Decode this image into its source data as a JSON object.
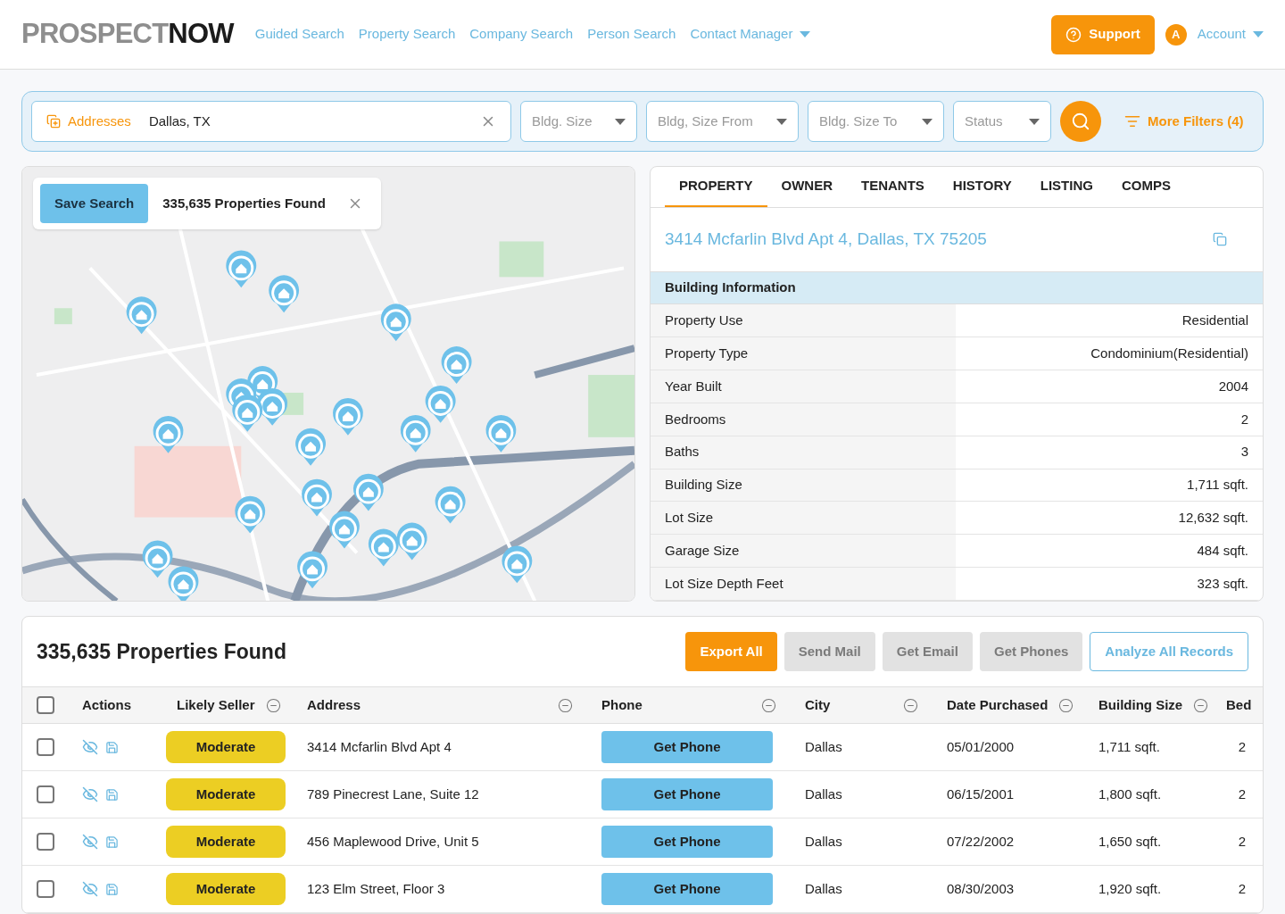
{
  "logo": {
    "part_1": "PROSPECT",
    "part_2": "NOW"
  },
  "nav": [
    {
      "label": "Guided Search",
      "dropdown": false
    },
    {
      "label": "Property Search",
      "dropdown": false
    },
    {
      "label": "Company Search",
      "dropdown": false
    },
    {
      "label": "Person Search",
      "dropdown": false
    },
    {
      "label": "Contact Manager",
      "dropdown": true
    }
  ],
  "support_button": "Support",
  "account": {
    "initial": "A",
    "label": "Account"
  },
  "search": {
    "type_label": "Addresses",
    "value": "Dallas, TX",
    "filters": [
      {
        "placeholder": "Bldg. Size"
      },
      {
        "placeholder": "Bldg, Size From"
      },
      {
        "placeholder": "Bldg. Size To"
      },
      {
        "placeholder": "Status"
      }
    ],
    "more_filters": "More Filters (4)"
  },
  "map": {
    "save_button": "Save Search",
    "result_count": "335,635 Properties Found"
  },
  "detail": {
    "tabs": [
      {
        "label": "PROPERTY",
        "selected": true
      },
      {
        "label": "OWNER",
        "selected": false
      },
      {
        "label": "TENANTS",
        "selected": false
      },
      {
        "label": "HISTORY",
        "selected": false
      },
      {
        "label": "LISTING",
        "selected": false
      },
      {
        "label": "COMPS",
        "selected": false
      }
    ],
    "address": "3414 Mcfarlin Blvd Apt 4, Dallas, TX 75205",
    "section": "Building Information",
    "rows": [
      {
        "label": "Property Use",
        "value": "Residential"
      },
      {
        "label": "Property Type",
        "value": "Condominium(Residential)"
      },
      {
        "label": "Year Built",
        "value": "2004"
      },
      {
        "label": "Bedrooms",
        "value": "2"
      },
      {
        "label": "Baths",
        "value": "3"
      },
      {
        "label": "Building Size",
        "value": "1,711 sqft."
      },
      {
        "label": "Lot Size",
        "value": "12,632 sqft."
      },
      {
        "label": "Garage Size",
        "value": "484 sqft."
      },
      {
        "label": "Lot Size Depth Feet",
        "value": "323 sqft."
      }
    ]
  },
  "results": {
    "title": "335,635 Properties Found",
    "buttons": [
      {
        "label": "Export All",
        "kind": "primary"
      },
      {
        "label": "Send Mail",
        "kind": "muted"
      },
      {
        "label": "Get Email",
        "kind": "muted"
      },
      {
        "label": "Get Phones",
        "kind": "muted"
      },
      {
        "label": "Analyze All Records",
        "kind": "outline"
      }
    ],
    "select_all": {
      "checked": false
    },
    "columns": [
      {
        "label": "Actions",
        "removable": false
      },
      {
        "label": "Likely Seller",
        "removable": true
      },
      {
        "label": "Address",
        "removable": true
      },
      {
        "label": "Phone",
        "removable": true
      },
      {
        "label": "City",
        "removable": true
      },
      {
        "label": "Date Purchased",
        "removable": true
      },
      {
        "label": "Building Size",
        "removable": true
      },
      {
        "label": "Bed"
      }
    ],
    "rows": [
      {
        "checked": false,
        "likely_seller": "Moderate",
        "address": "3414 Mcfarlin Blvd Apt 4",
        "phone": "Get Phone",
        "city": "Dallas",
        "date": "05/01/2000",
        "size": "1,711 sqft.",
        "bed": "2"
      },
      {
        "checked": false,
        "likely_seller": "Moderate",
        "address": "789 Pinecrest Lane, Suite 12",
        "phone": "Get Phone",
        "city": "Dallas",
        "date": "06/15/2001",
        "size": "1,800 sqft.",
        "bed": "2"
      },
      {
        "checked": false,
        "likely_seller": "Moderate",
        "address": "456 Maplewood Drive, Unit 5",
        "phone": "Get Phone",
        "city": "Dallas",
        "date": "07/22/2002",
        "size": "1,650 sqft.",
        "bed": "2"
      },
      {
        "checked": false,
        "likely_seller": "Moderate",
        "address": "123 Elm Street, Floor 3",
        "phone": "Get Phone",
        "city": "Dallas",
        "date": "08/30/2003",
        "size": "1,920 sqft.",
        "bed": "2"
      }
    ]
  }
}
